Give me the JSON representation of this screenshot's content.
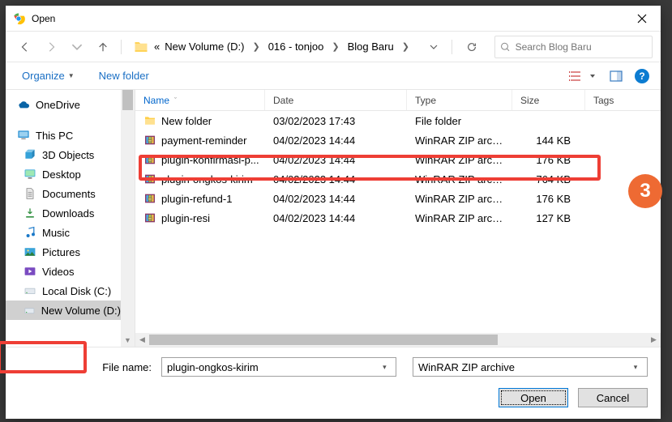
{
  "title": "Open",
  "path": {
    "pre": "«",
    "segments": [
      "New Volume (D:)",
      "016 - tonjoo",
      "Blog Baru"
    ]
  },
  "search_placeholder": "Search Blog Baru",
  "toolbar": {
    "organize": "Organize",
    "new_folder": "New folder"
  },
  "columns": {
    "name": "Name",
    "date": "Date",
    "type": "Type",
    "size": "Size",
    "tags": "Tags"
  },
  "sidebar": {
    "onedrive": "OneDrive",
    "thispc": "This PC",
    "items": [
      "3D Objects",
      "Desktop",
      "Documents",
      "Downloads",
      "Music",
      "Pictures",
      "Videos",
      "Local Disk (C:)",
      "New Volume (D:)"
    ]
  },
  "files": [
    {
      "name": "New folder",
      "date": "03/02/2023 17:43",
      "type": "File folder",
      "size": "",
      "icon": "folder"
    },
    {
      "name": "payment-reminder",
      "date": "04/02/2023 14:44",
      "type": "WinRAR ZIP archive",
      "size": "144 KB",
      "icon": "zip"
    },
    {
      "name": "plugin-konfirmasi-p...",
      "date": "04/02/2023 14:44",
      "type": "WinRAR ZIP archive",
      "size": "176 KB",
      "icon": "zip"
    },
    {
      "name": "plugin-ongkos-kirim",
      "date": "04/02/2023 14:44",
      "type": "WinRAR ZIP archive",
      "size": "764 KB",
      "icon": "zip"
    },
    {
      "name": "plugin-refund-1",
      "date": "04/02/2023 14:44",
      "type": "WinRAR ZIP archive",
      "size": "176 KB",
      "icon": "zip"
    },
    {
      "name": "plugin-resi",
      "date": "04/02/2023 14:44",
      "type": "WinRAR ZIP archive",
      "size": "127 KB",
      "icon": "zip"
    }
  ],
  "filename_label": "File name:",
  "filename_value": "plugin-ongkos-kirim",
  "filter_value": "WinRAR ZIP archive",
  "buttons": {
    "open": "Open",
    "cancel": "Cancel"
  },
  "badge_step": "3"
}
